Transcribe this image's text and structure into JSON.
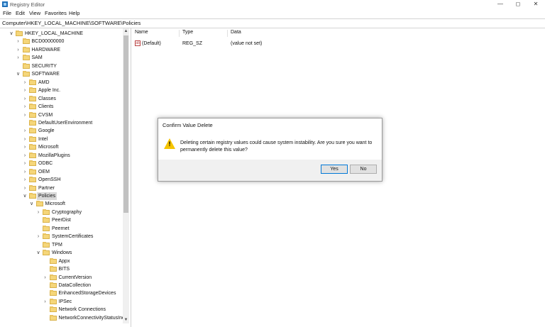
{
  "window": {
    "title": "Registry Editor",
    "controls": {
      "minimize": "—",
      "maximize": "◻",
      "close": "✕"
    }
  },
  "menu": [
    "File",
    "Edit",
    "View",
    "Favorites",
    "Help"
  ],
  "address": "Computer\\HKEY_LOCAL_MACHINE\\SOFTWARE\\Policies",
  "tree": [
    {
      "label": "HKEY_LOCAL_MACHINE",
      "depth": 0,
      "state": "expanded"
    },
    {
      "label": "BCD00000000",
      "depth": 1,
      "state": "collapsed"
    },
    {
      "label": "HARDWARE",
      "depth": 1,
      "state": "collapsed"
    },
    {
      "label": "SAM",
      "depth": 1,
      "state": "collapsed"
    },
    {
      "label": "SECURITY",
      "depth": 1,
      "state": "none"
    },
    {
      "label": "SOFTWARE",
      "depth": 1,
      "state": "expanded"
    },
    {
      "label": "AMD",
      "depth": 2,
      "state": "collapsed"
    },
    {
      "label": "Apple Inc.",
      "depth": 2,
      "state": "collapsed"
    },
    {
      "label": "Classes",
      "depth": 2,
      "state": "collapsed"
    },
    {
      "label": "Clients",
      "depth": 2,
      "state": "collapsed"
    },
    {
      "label": "CVSM",
      "depth": 2,
      "state": "collapsed"
    },
    {
      "label": "DefaultUserEnvironment",
      "depth": 2,
      "state": "none"
    },
    {
      "label": "Google",
      "depth": 2,
      "state": "collapsed"
    },
    {
      "label": "Intel",
      "depth": 2,
      "state": "collapsed"
    },
    {
      "label": "Microsoft",
      "depth": 2,
      "state": "collapsed"
    },
    {
      "label": "MozillaPlugins",
      "depth": 2,
      "state": "collapsed"
    },
    {
      "label": "ODBC",
      "depth": 2,
      "state": "collapsed"
    },
    {
      "label": "OEM",
      "depth": 2,
      "state": "collapsed"
    },
    {
      "label": "OpenSSH",
      "depth": 2,
      "state": "collapsed"
    },
    {
      "label": "Partner",
      "depth": 2,
      "state": "collapsed"
    },
    {
      "label": "Policies",
      "depth": 2,
      "state": "expanded",
      "selected": true
    },
    {
      "label": "Microsoft",
      "depth": 3,
      "state": "expanded"
    },
    {
      "label": "Cryptography",
      "depth": 4,
      "state": "collapsed"
    },
    {
      "label": "PeerDist",
      "depth": 4,
      "state": "none"
    },
    {
      "label": "Peernet",
      "depth": 4,
      "state": "none"
    },
    {
      "label": "SystemCertificates",
      "depth": 4,
      "state": "collapsed"
    },
    {
      "label": "TPM",
      "depth": 4,
      "state": "none"
    },
    {
      "label": "Windows",
      "depth": 4,
      "state": "expanded"
    },
    {
      "label": "Appx",
      "depth": 5,
      "state": "none"
    },
    {
      "label": "BITS",
      "depth": 5,
      "state": "none"
    },
    {
      "label": "CurrentVersion",
      "depth": 5,
      "state": "collapsed"
    },
    {
      "label": "DataCollection",
      "depth": 5,
      "state": "none"
    },
    {
      "label": "EnhancedStorageDevices",
      "depth": 5,
      "state": "none"
    },
    {
      "label": "IPSec",
      "depth": 5,
      "state": "collapsed"
    },
    {
      "label": "Network Connections",
      "depth": 5,
      "state": "none"
    },
    {
      "label": "NetworkConnectivityStatusIndic",
      "depth": 5,
      "state": "none"
    }
  ],
  "list": {
    "columns": [
      "Name",
      "Type",
      "Data"
    ],
    "rows": [
      {
        "name": "(Default)",
        "type": "REG_SZ",
        "data": "(value not set)",
        "icon": "string-value-icon"
      }
    ]
  },
  "dialog": {
    "title": "Confirm Value Delete",
    "message": "Deleting certain registry values could cause system instability. Are you sure you want to permanently delete this value?",
    "icon": "warning-icon",
    "yes_label": "Yes",
    "no_label": "No"
  }
}
